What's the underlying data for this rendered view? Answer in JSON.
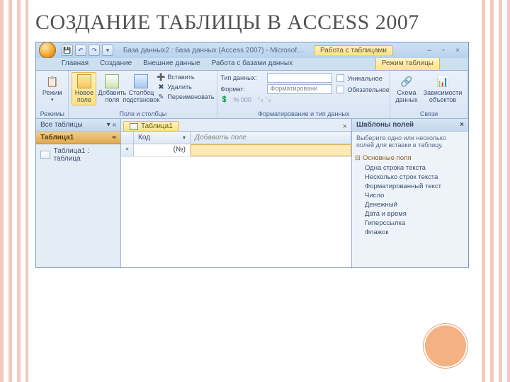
{
  "slide_title": "СОЗДАНИЕ ТАБЛИЦЫ В ACCESS 2007",
  "titlebar": {
    "title": "База данных2 : база данных (Access 2007) - Microsof…",
    "context_title": "Работа с таблицами",
    "min": "–",
    "max": "▫",
    "close": "×"
  },
  "tabs": {
    "home": "Главная",
    "create": "Создание",
    "external": "Внешние данные",
    "dbtools": "Работа с базами данных",
    "context": "Режим таблицы"
  },
  "ribbon": {
    "views": {
      "btn": "Режим",
      "group": "Режимы"
    },
    "fields": {
      "new_field": "Новое поле",
      "add_fields": "Добавить поля",
      "column": "Столбец подстановок",
      "insert": "Вставить",
      "delete": "Удалить",
      "rename": "Переименовать",
      "group": "Поля и столбцы"
    },
    "format": {
      "datatype_lbl": "Тип данных:",
      "format_lbl": "Формат:",
      "format_val": "Форматировани",
      "unique_lbl": "Уникальное",
      "required_lbl": "Обязательное",
      "currency_hint": "% 000",
      "group": "Форматирование и тип данных"
    },
    "rel": {
      "schema": "Схема данных",
      "deps": "Зависимости объектов",
      "group": "Связи"
    }
  },
  "nav": {
    "header": "Все таблицы",
    "category": "Таблица1",
    "item": "Таблица1 : таблица"
  },
  "doc": {
    "tab": "Таблица1",
    "id_header": "Код",
    "add_header": "Добавить поле",
    "id_value": "(№)",
    "row_marker": "*"
  },
  "taskpane": {
    "title": "Шаблоны полей",
    "desc": "Выберите одно или несколько полей для вставки в таблицу.",
    "group": "Основные поля",
    "items": [
      "Одна строка текста",
      "Несколько строк текста",
      "Форматированный текст",
      "Число",
      "Денежный",
      "Дата и время",
      "Гиперссылка",
      "Флажок"
    ]
  }
}
